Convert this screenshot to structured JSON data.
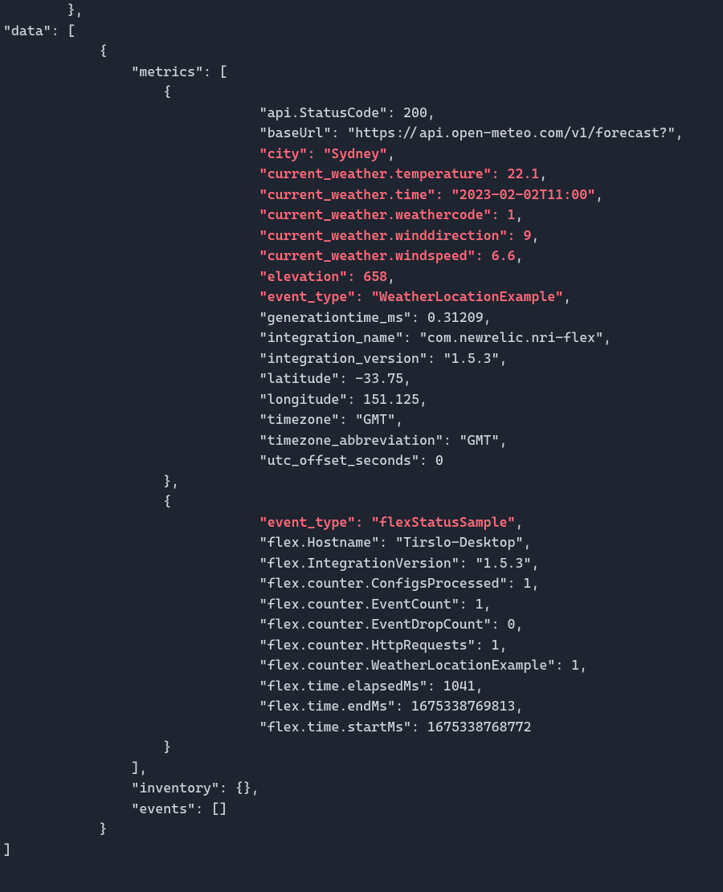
{
  "code": {
    "topFragment": {
      "closeBrace": "        },",
      "dataKey": "\"data\"",
      "openArray": ": [",
      "openObj": "            {"
    },
    "indent": {
      "metricsLabel": "                \"metrics\": [",
      "obj1Open": "                    {",
      "kvIndent": "                                ",
      "obj1Close": "                    },",
      "obj2Open": "                    {",
      "obj2Close": "                    }",
      "metricsClose": "                ],",
      "inventory": "                \"inventory\": {},",
      "events": "                \"events\": []",
      "dataObjClose": "            }",
      "dataArrClose": "]"
    },
    "obj1": [
      {
        "key": "\"api.StatusCode\"",
        "sep": ": ",
        "val": "200",
        "trail": ",",
        "hl": false,
        "isString": false
      },
      {
        "key": "\"baseUrl\"",
        "sep": ": ",
        "val": "\"https://api.open-meteo.com/v1/forecast?\"",
        "trail": ",",
        "hl": false,
        "isString": true
      },
      {
        "key": "\"city\"",
        "sep": ": ",
        "val": "\"Sydney\"",
        "trail": ",",
        "hl": true,
        "isString": true
      },
      {
        "key": "\"current_weather.temperature\"",
        "sep": ": ",
        "val": "22.1",
        "trail": ",",
        "hl": true,
        "isString": false
      },
      {
        "key": "\"current_weather.time\"",
        "sep": ": ",
        "val": "\"2023-02-02T11:00\"",
        "trail": ",",
        "hl": true,
        "isString": true
      },
      {
        "key": "\"current_weather.weathercode\"",
        "sep": ": ",
        "val": "1",
        "trail": ",",
        "hl": true,
        "isString": false
      },
      {
        "key": "\"current_weather.winddirection\"",
        "sep": ": ",
        "val": "9",
        "trail": ",",
        "hl": true,
        "isString": false
      },
      {
        "key": "\"current_weather.windspeed\"",
        "sep": ": ",
        "val": "6.6",
        "trail": ",",
        "hl": true,
        "isString": false
      },
      {
        "key": "\"elevation\"",
        "sep": ": ",
        "val": "658",
        "trail": ",",
        "hl": true,
        "isString": false
      },
      {
        "key": "\"event_type\"",
        "sep": ": ",
        "val": "\"WeatherLocationExample\"",
        "trail": ",",
        "hl": true,
        "isString": true
      },
      {
        "key": "\"generationtime_ms\"",
        "sep": ": ",
        "val": "0.31209",
        "trail": ",",
        "hl": false,
        "isString": false
      },
      {
        "key": "\"integration_name\"",
        "sep": ": ",
        "val": "\"com.newrelic.nri-flex\"",
        "trail": ",",
        "hl": false,
        "isString": true
      },
      {
        "key": "\"integration_version\"",
        "sep": ": ",
        "val": "\"1.5.3\"",
        "trail": ",",
        "hl": false,
        "isString": true
      },
      {
        "key": "\"latitude\"",
        "sep": ": ",
        "val": "-33.75",
        "trail": ",",
        "hl": false,
        "isString": false
      },
      {
        "key": "\"longitude\"",
        "sep": ": ",
        "val": "151.125",
        "trail": ",",
        "hl": false,
        "isString": false
      },
      {
        "key": "\"timezone\"",
        "sep": ": ",
        "val": "\"GMT\"",
        "trail": ",",
        "hl": false,
        "isString": true
      },
      {
        "key": "\"timezone_abbreviation\"",
        "sep": ": ",
        "val": "\"GMT\"",
        "trail": ",",
        "hl": false,
        "isString": true
      },
      {
        "key": "\"utc_offset_seconds\"",
        "sep": ": ",
        "val": "0",
        "trail": "",
        "hl": false,
        "isString": false
      }
    ],
    "obj2": [
      {
        "key": "\"event_type\"",
        "sep": ": ",
        "val": "\"flexStatusSample\"",
        "trail": ",",
        "hl": true,
        "isString": true
      },
      {
        "key": "\"flex.Hostname\"",
        "sep": ": ",
        "val": "\"Tirslo-Desktop\"",
        "trail": ",",
        "hl": false,
        "isString": true
      },
      {
        "key": "\"flex.IntegrationVersion\"",
        "sep": ": ",
        "val": "\"1.5.3\"",
        "trail": ",",
        "hl": false,
        "isString": true
      },
      {
        "key": "\"flex.counter.ConfigsProcessed\"",
        "sep": ": ",
        "val": "1",
        "trail": ",",
        "hl": false,
        "isString": false
      },
      {
        "key": "\"flex.counter.EventCount\"",
        "sep": ": ",
        "val": "1",
        "trail": ",",
        "hl": false,
        "isString": false
      },
      {
        "key": "\"flex.counter.EventDropCount\"",
        "sep": ": ",
        "val": "0",
        "trail": ",",
        "hl": false,
        "isString": false
      },
      {
        "key": "\"flex.counter.HttpRequests\"",
        "sep": ": ",
        "val": "1",
        "trail": ",",
        "hl": false,
        "isString": false
      },
      {
        "key": "\"flex.counter.WeatherLocationExample\"",
        "sep": ": ",
        "val": "1",
        "trail": ",",
        "hl": false,
        "isString": false
      },
      {
        "key": "\"flex.time.elapsedMs\"",
        "sep": ": ",
        "val": "1041",
        "trail": ",",
        "hl": false,
        "isString": false
      },
      {
        "key": "\"flex.time.endMs\"",
        "sep": ": ",
        "val": "1675338769813",
        "trail": ",",
        "hl": false,
        "isString": false
      },
      {
        "key": "\"flex.time.startMs\"",
        "sep": ": ",
        "val": "1675338768772",
        "trail": "",
        "hl": false,
        "isString": false
      }
    ]
  }
}
